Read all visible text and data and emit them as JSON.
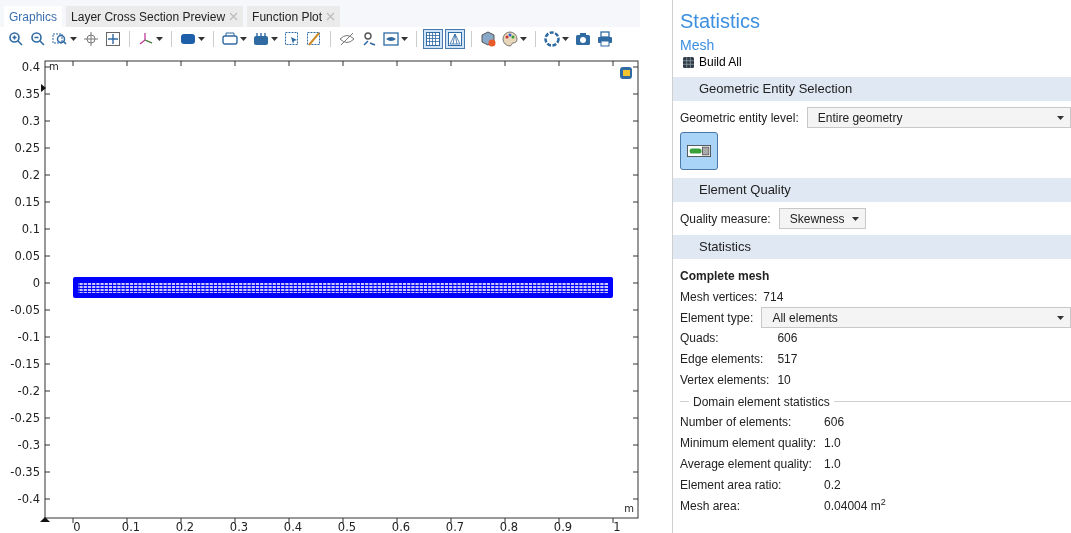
{
  "tabs": [
    {
      "label": "Graphics",
      "selected": true,
      "closable": false
    },
    {
      "label": "Layer Cross Section Preview",
      "selected": false,
      "closable": true
    },
    {
      "label": "Function Plot",
      "selected": false,
      "closable": true
    }
  ],
  "toolbar": [
    [
      {
        "selected": false,
        "menu": false
      },
      {
        "selected": false,
        "menu": false
      },
      {
        "selected": false,
        "menu": true
      },
      {
        "selected": false,
        "menu": false
      },
      {
        "selected": false,
        "menu": false
      }
    ],
    [
      {
        "selected": false,
        "menu": true
      }
    ],
    [
      {
        "selected": false,
        "menu": true
      }
    ],
    [
      {
        "selected": false,
        "menu": true
      },
      {
        "selected": false,
        "menu": true
      },
      {
        "selected": false,
        "menu": false
      },
      {
        "selected": false,
        "menu": false
      }
    ],
    [
      {
        "selected": false,
        "menu": false
      },
      {
        "selected": false,
        "menu": false
      },
      {
        "selected": false,
        "menu": true
      }
    ],
    [
      {
        "selected": true,
        "menu": false
      },
      {
        "selected": true,
        "menu": false
      }
    ],
    [
      {
        "selected": false,
        "menu": false
      },
      {
        "selected": false,
        "menu": true
      }
    ],
    [
      {
        "selected": false,
        "menu": true
      },
      {
        "selected": false,
        "menu": false
      },
      {
        "selected": false,
        "menu": false
      }
    ]
  ],
  "plot": {
    "y_unit": "m",
    "x_unit": "m",
    "y_ticks": [
      "0.4",
      "0.35",
      "0.3",
      "0.25",
      "0.2",
      "0.15",
      "0.1",
      "0.05",
      "0",
      "-0.05",
      "-0.1",
      "-0.15",
      "-0.2",
      "-0.25",
      "-0.3",
      "-0.35",
      "-0.4"
    ],
    "x_ticks": [
      "0",
      "0.1",
      "0.2",
      "0.3",
      "0.4",
      "0.5",
      "0.6",
      "0.7",
      "0.8",
      "0.9",
      "1"
    ]
  },
  "panel": {
    "title": "Statistics",
    "subtitle": "Mesh",
    "build_button": "Build All",
    "sections": [
      {
        "title": "Geometric Entity Selection",
        "rows": [
          {
            "kind": "select",
            "label": "Geometric entity level:",
            "value": "Entire geometry",
            "wide": true
          },
          {
            "kind": "toggle",
            "selected": true
          }
        ]
      },
      {
        "title": "Element Quality",
        "rows": [
          {
            "kind": "select",
            "label": "Quality measure:",
            "value": "Skewness",
            "wide": false
          }
        ]
      },
      {
        "title": "Statistics",
        "rows": [
          {
            "kind": "heading",
            "text": "Complete mesh"
          },
          {
            "kind": "inline",
            "label": "Mesh vertices:",
            "value": "714"
          },
          {
            "kind": "select",
            "label": "Element type:",
            "value": "All elements",
            "wide": true
          },
          {
            "kind": "pair",
            "label": "Quads:",
            "value": "606"
          },
          {
            "kind": "pair",
            "label": "Edge elements:",
            "value": "517"
          },
          {
            "kind": "pair",
            "label": "Vertex elements:",
            "value": "10"
          },
          {
            "kind": "group",
            "text": "Domain element statistics"
          },
          {
            "kind": "pair",
            "label": "Number of elements:",
            "value": "606"
          },
          {
            "kind": "pair",
            "label": "Minimum element quality:",
            "value": "1.0"
          },
          {
            "kind": "pair",
            "label": "Average element quality:",
            "value": "1.0"
          },
          {
            "kind": "pair",
            "label": "Element area ratio:",
            "value": "0.2"
          },
          {
            "kind": "pair",
            "label": "Mesh area:",
            "value": "0.04004 m$^{2}$"
          }
        ]
      }
    ]
  }
}
